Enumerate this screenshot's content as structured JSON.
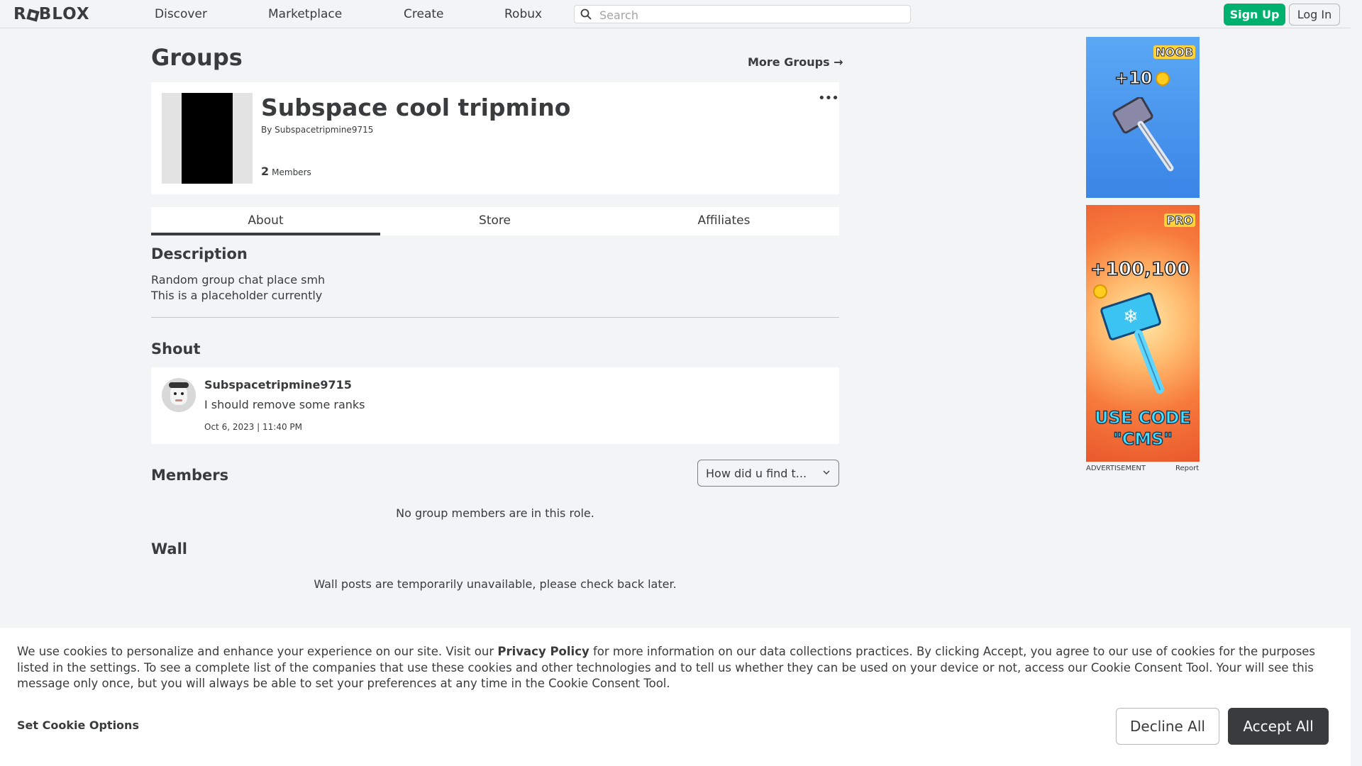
{
  "nav": {
    "logo": "ROBLOX",
    "links": [
      "Discover",
      "Marketplace",
      "Create",
      "Robux"
    ],
    "search_placeholder": "Search",
    "signup_label": "Sign Up",
    "login_label": "Log In"
  },
  "page": {
    "title": "Groups",
    "more_groups": "More Groups →"
  },
  "group": {
    "name": "Subspace cool tripmino",
    "by_prefix": "By",
    "owner": "Subspacetripmine9715",
    "member_count": "2",
    "members_label": "Members"
  },
  "tabs": [
    "About",
    "Store",
    "Affiliates"
  ],
  "description": {
    "title": "Description",
    "line1": "Random group chat place smh",
    "line2": "This is a placeholder currently"
  },
  "shout": {
    "title": "Shout",
    "user": "Subspacetripmine9715",
    "message": "I should remove some ranks",
    "date": "Oct 6, 2023 | 11:40 PM"
  },
  "members": {
    "title": "Members",
    "role_selected": "How did u find t...",
    "empty": "No group members are in this role."
  },
  "wall": {
    "title": "Wall",
    "message": "Wall posts are temporarily unavailable, please check back later."
  },
  "ads": {
    "ad1_tag": "NOOB",
    "ad1_amount": "+10",
    "ad2_tag": "PRO",
    "ad2_amount": "+100,100",
    "ad2_code_line1": "USE CODE",
    "ad2_code_line2": "\"CMS\"",
    "advertisement_label": "ADVERTISEMENT",
    "report_label": "Report"
  },
  "cookie": {
    "text_before": "We use cookies to personalize and enhance your experience on our site. Visit our ",
    "privacy_link": "Privacy Policy",
    "text_after": " for more information on our data collections practices. By clicking Accept, you agree to our use of cookies for the purposes listed in the settings. To see a complete list of the companies that use these cookies and other technologies and to tell us whether they can be used on your device or not, access our Cookie Consent Tool. Your will see this message only once, but you will always be able to set your preferences at any time in the Cookie Consent Tool.",
    "options_label": "Set Cookie Options",
    "decline_label": "Decline All",
    "accept_label": "Accept All"
  },
  "colors": {
    "accent_green": "#00b06f",
    "text": "#393b3d",
    "background": "#f2f4f5"
  }
}
